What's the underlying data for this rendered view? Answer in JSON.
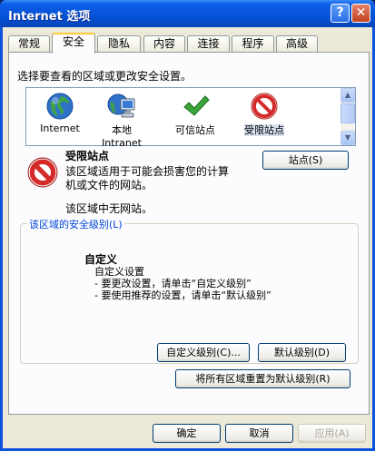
{
  "window": {
    "title": "Internet 选项",
    "help_glyph": "?",
    "close_glyph": "✕"
  },
  "tabs": [
    {
      "label": "常规"
    },
    {
      "label": "安全"
    },
    {
      "label": "隐私"
    },
    {
      "label": "内容"
    },
    {
      "label": "连接"
    },
    {
      "label": "程序"
    },
    {
      "label": "高级"
    }
  ],
  "active_tab": "安全",
  "security": {
    "instruction": "选择要查看的区域或更改安全设置。",
    "zones": [
      {
        "label": "Internet",
        "icon": "globe-icon"
      },
      {
        "label": "本地\nIntranet",
        "icon": "intranet-icon"
      },
      {
        "label": "可信站点",
        "icon": "checkmark-icon"
      },
      {
        "label": "受限站点",
        "icon": "restricted-icon",
        "selected": true
      }
    ],
    "zone_title": "受限站点",
    "zone_desc": "该区域适用于可能会损害您的计算\n机或文件的网站。",
    "zone_note": "该区域中无网站。",
    "sites_button": "站点(S)",
    "level_group_title": "该区域的安全级别(L)",
    "custom_title": "自定义",
    "custom_text": "自定义设置\n - 要更改设置，请单击“自定义级别”\n - 要使用推荐的设置，请单击“默认级别”",
    "custom_level_button": "自定义级别(C)...",
    "default_level_button": "默认级别(D)",
    "reset_all_button": "将所有区域重置为默认级别(R)"
  },
  "footer": {
    "ok": "确定",
    "cancel": "取消",
    "apply": "应用(A)"
  }
}
